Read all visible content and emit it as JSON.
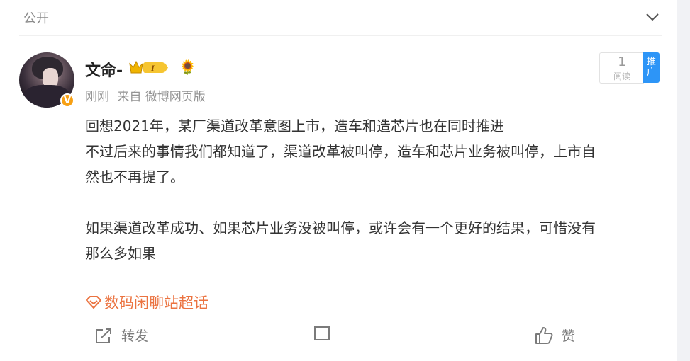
{
  "header": {
    "visibility": "公开"
  },
  "user": {
    "name": "文命-",
    "verified_badge": "V",
    "level_badge": "I",
    "emoji": "🌻"
  },
  "meta": {
    "time": "刚刚",
    "source": "来自 微博网页版"
  },
  "stats": {
    "read_count": "1",
    "read_label": "阅读",
    "promote_label": "推广"
  },
  "post": {
    "para1_line1": "回想2021年，某厂渠道改革意图上市，造车和造芯片也在同时推进",
    "para1_line2": "不过后来的事情我们都知道了，渠道改革被叫停，造车和芯片业务被叫停，上市自",
    "para1_line3": "然也不再提了。",
    "para2_line1": "如果渠道改革成功、如果芯片业务没被叫停，或许会有一个更好的结果，可惜没有",
    "para2_line2": "那么多如果"
  },
  "topic": {
    "label": "数码闲聊站超话"
  },
  "actions": {
    "forward": "转发",
    "like": "赞"
  },
  "colors": {
    "accent_orange": "#eb7340",
    "promote_blue": "#2d95f7",
    "verified_orange": "#f7a014"
  }
}
